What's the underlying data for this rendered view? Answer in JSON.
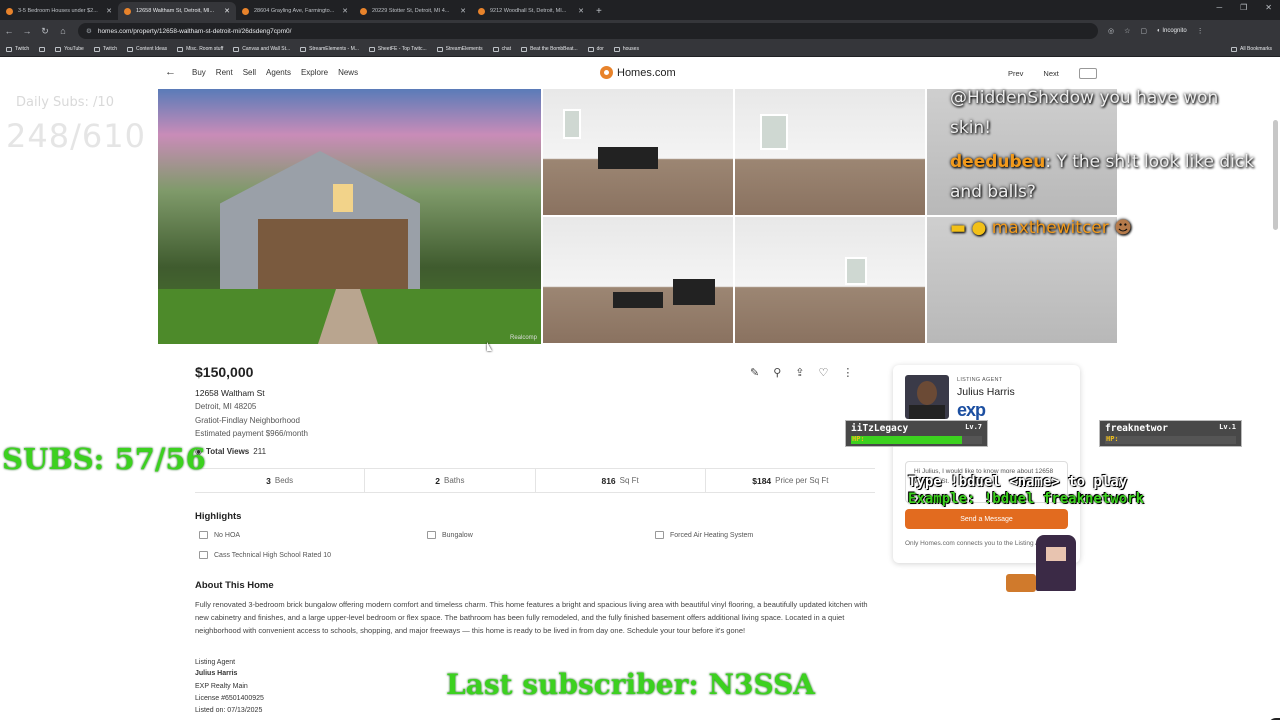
{
  "browser": {
    "tabs": [
      {
        "title": "3-5 Bedroom Houses under $2..."
      },
      {
        "title": "12658 Waltham St, Detroit, MI..."
      },
      {
        "title": "28604 Grayling Ave, Farmingto..."
      },
      {
        "title": "20229 Stotter St, Detroit, MI 4..."
      },
      {
        "title": "9212 Woodhall St, Detroit, MI..."
      }
    ],
    "url": "homes.com/property/12658-waltham-st-detroit-mi/26dsdeng7cpm0/",
    "incognito_label": "Incognito",
    "bookmarks": [
      "Twitch",
      "",
      "YouTube",
      "Twitch",
      "Content Ideas",
      "Misc. Room stuff",
      "Canvas and Wall St...",
      "StreamElements - M...",
      "SheetFE - Top Twitc...",
      "StreamElements",
      "chat",
      "Beat the BombBeat...",
      "dor",
      "houses"
    ],
    "all_bookmarks": "All Bookmarks"
  },
  "site": {
    "nav": [
      "Buy",
      "Rent",
      "Sell",
      "Agents",
      "Explore",
      "News"
    ],
    "logo": "Homes.com",
    "prev": "Prev",
    "next": "Next",
    "photo_credit": "Realcomp"
  },
  "listing": {
    "price": "$150,000",
    "street": "12658 Waltham St",
    "city": "Detroit, MI 48205",
    "neighborhood": "Gratiot-Findlay Neighborhood",
    "payment": "Estimated payment $966/month",
    "views_label": "Total Views",
    "views": "211",
    "stats": [
      {
        "value": "3",
        "label": "Beds"
      },
      {
        "value": "2",
        "label": "Baths"
      },
      {
        "value": "816",
        "label": "Sq Ft"
      },
      {
        "value": "$184",
        "label": "Price per Sq Ft"
      }
    ],
    "highlights_title": "Highlights",
    "highlights": [
      "No HOA",
      "Bungalow",
      "Forced Air Heating System",
      "Cass Technical High School Rated 10"
    ],
    "about_title": "About This Home",
    "about": "Fully renovated 3-bedroom brick bungalow offering modern comfort and timeless charm. This home features a bright and spacious living area with beautiful vinyl flooring, a beautifully updated kitchen with new cabinetry and finishes, and a large upper-level bedroom or flex space. The bathroom has been fully remodeled, and the fully finished basement offers additional living space. Located in a quiet neighborhood with convenient access to schools, shopping, and major freeways — this home is ready to be lived in from day one. Schedule your tour before it's gone!",
    "listing_agent_label": "Listing Agent",
    "agent_name": "Julius Harris",
    "brokerage": "EXP Realty Main",
    "license": "License #6501400925",
    "listed_on": "Listed on: 07/13/2025"
  },
  "agent_card": {
    "label": "LISTING AGENT",
    "name": "Julius Harris",
    "brand": "exp",
    "message": "Hi Julius, I would like to know more about 12658 Waltham St.",
    "send": "Send a Message",
    "note": "Only Homes.com connects you to the Listing Agent."
  },
  "overlay": {
    "daily_subs": "Daily Subs: /10",
    "subs_total": "248/610",
    "subs_green": "SUBS: 57/56",
    "last_subscriber": "Last subscriber: N3SSA",
    "chat": [
      {
        "user": "",
        "text": "@HiddenShxdow you have won"
      },
      {
        "user": "",
        "text": "skin!"
      },
      {
        "user": "deedubeu",
        "text": ": Y the sh!t look like dick"
      },
      {
        "user": "",
        "text": "and balls?"
      },
      {
        "user": "maxthewitcer",
        "text": ""
      }
    ],
    "duel": [
      {
        "name": "iiTzLegacy",
        "level": "Lv.7",
        "hp": 0.85
      },
      {
        "name": "freaknetwor",
        "level": "Lv.1",
        "hp": 0.0
      }
    ],
    "hp_label": "HP:",
    "duel_line1": "Type !bduel <name> to play",
    "duel_line2": "Example: !bduel freaknetwork"
  }
}
